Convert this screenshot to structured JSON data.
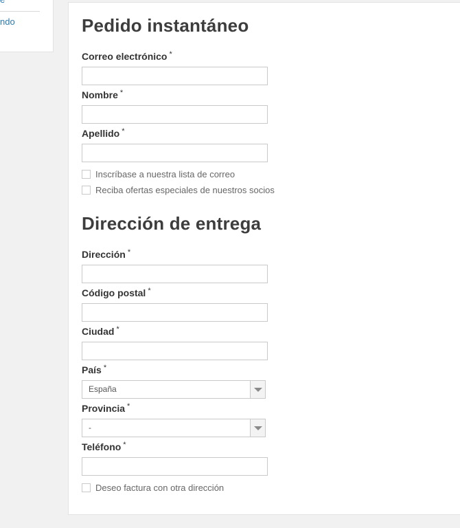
{
  "sidebar": {
    "link_top": "e",
    "link": "ndo"
  },
  "contact_section": {
    "title": "Pedido instantáneo",
    "email_label": "Correo electrónico",
    "first_name_label": "Nombre",
    "last_name_label": "Apellido",
    "newsletter_label": "Inscríbase a nuestra lista de correo",
    "offers_label": "Reciba ofertas especiales de nuestros socios"
  },
  "delivery_section": {
    "title": "Dirección de entrega",
    "address_label": "Dirección",
    "postal_code_label": "Código postal",
    "city_label": "Ciudad",
    "country_label": "País",
    "country_value": "España",
    "province_label": "Provincia",
    "province_value": "-",
    "phone_label": "Teléfono",
    "invoice_other_address_label": "Deseo factura con otra dirección"
  },
  "required_marker": "*"
}
